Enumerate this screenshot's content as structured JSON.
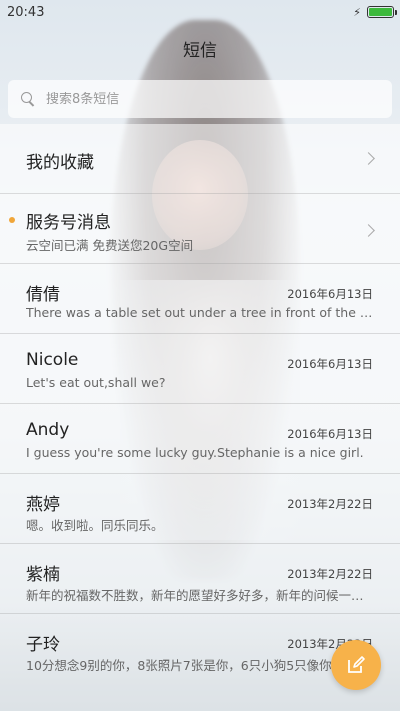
{
  "status_bar": {
    "time": "20:43",
    "charging_icon": "bolt-icon",
    "battery_level": 1.0
  },
  "header": {
    "title": "短信"
  },
  "search": {
    "placeholder": "搜索8条短信",
    "icon": "search-icon"
  },
  "special_items": [
    {
      "label": "我的收藏",
      "icon": "chevron-right-icon"
    },
    {
      "label": "服务号消息",
      "preview": "云空间已满 免费送您20G空间",
      "unread_dot_color": "#f0a63a",
      "icon": "chevron-right-icon"
    }
  ],
  "conversations": [
    {
      "name": "倩倩",
      "date": "2016年6月13日",
      "preview": "There was a table set out under a tree in front of the house"
    },
    {
      "name": "Nicole",
      "date": "2016年6月13日",
      "preview": "Let's eat out,shall we?"
    },
    {
      "name": "Andy",
      "date": "2016年6月13日",
      "preview": "I guess you're some lucky guy.Stephanie is a nice girl."
    },
    {
      "name": "燕婷",
      "date": "2013年2月22日",
      "preview": "嗯。收到啦。同乐同乐。"
    },
    {
      "name": "紫楠",
      "date": "2013年2月22日",
      "preview": "新年的祝福数不胜数，新年的愿望好多好多，新年的问候一条接一条"
    },
    {
      "name": "子玲",
      "date": "2013年2月22日",
      "preview": "10分想念9别的你，8张照片7张是你，6只小狗5只像你"
    }
  ],
  "fab": {
    "icon": "compose-icon",
    "color": "#f7b24a"
  }
}
